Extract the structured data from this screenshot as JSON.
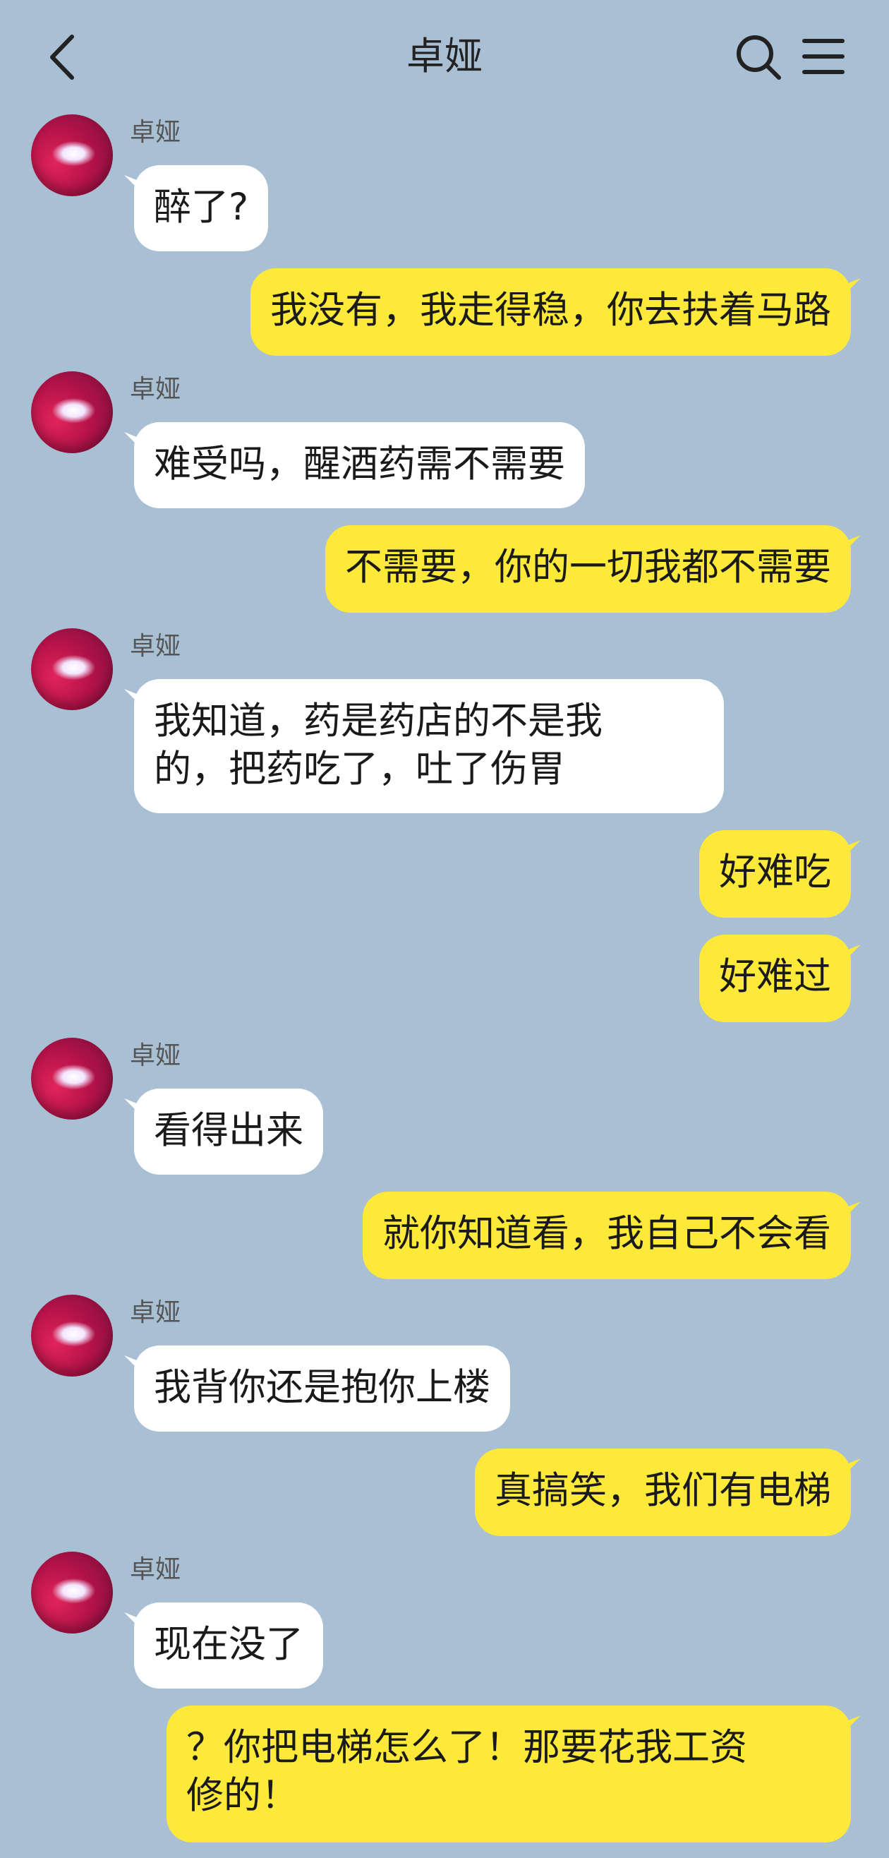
{
  "header": {
    "title": "卓娅"
  },
  "icons": {
    "back": "chevron-left-icon",
    "search": "search-icon",
    "menu": "menu-icon"
  },
  "colors": {
    "background": "#a9bfd4",
    "incoming_bubble": "#ffffff",
    "outgoing_bubble": "#fde93a"
  },
  "messages": [
    {
      "from": "卓娅",
      "text": "醉了?"
    },
    {
      "from": "me",
      "text": "我没有，我走得稳，你去扶着马路"
    },
    {
      "from": "卓娅",
      "text": "难受吗，醒酒药需不需要"
    },
    {
      "from": "me",
      "text": "不需要，你的一切我都不需要"
    },
    {
      "from": "卓娅",
      "text_line1": "我知道，药是药店的不是我",
      "text_line2": "的，把药吃了，吐了伤胃"
    },
    {
      "from": "me",
      "text": "好难吃"
    },
    {
      "from": "me",
      "text": "好难过"
    },
    {
      "from": "卓娅",
      "text": "看得出来"
    },
    {
      "from": "me",
      "text": "就你知道看，我自己不会看"
    },
    {
      "from": "卓娅",
      "text": "我背你还是抱你上楼"
    },
    {
      "from": "me",
      "text": "真搞笑，我们有电梯"
    },
    {
      "from": "卓娅",
      "text": "现在没了"
    },
    {
      "from": "me",
      "text_line1": "？你把电梯怎么了！那要花我工资",
      "text_line2": "修的！"
    }
  ]
}
